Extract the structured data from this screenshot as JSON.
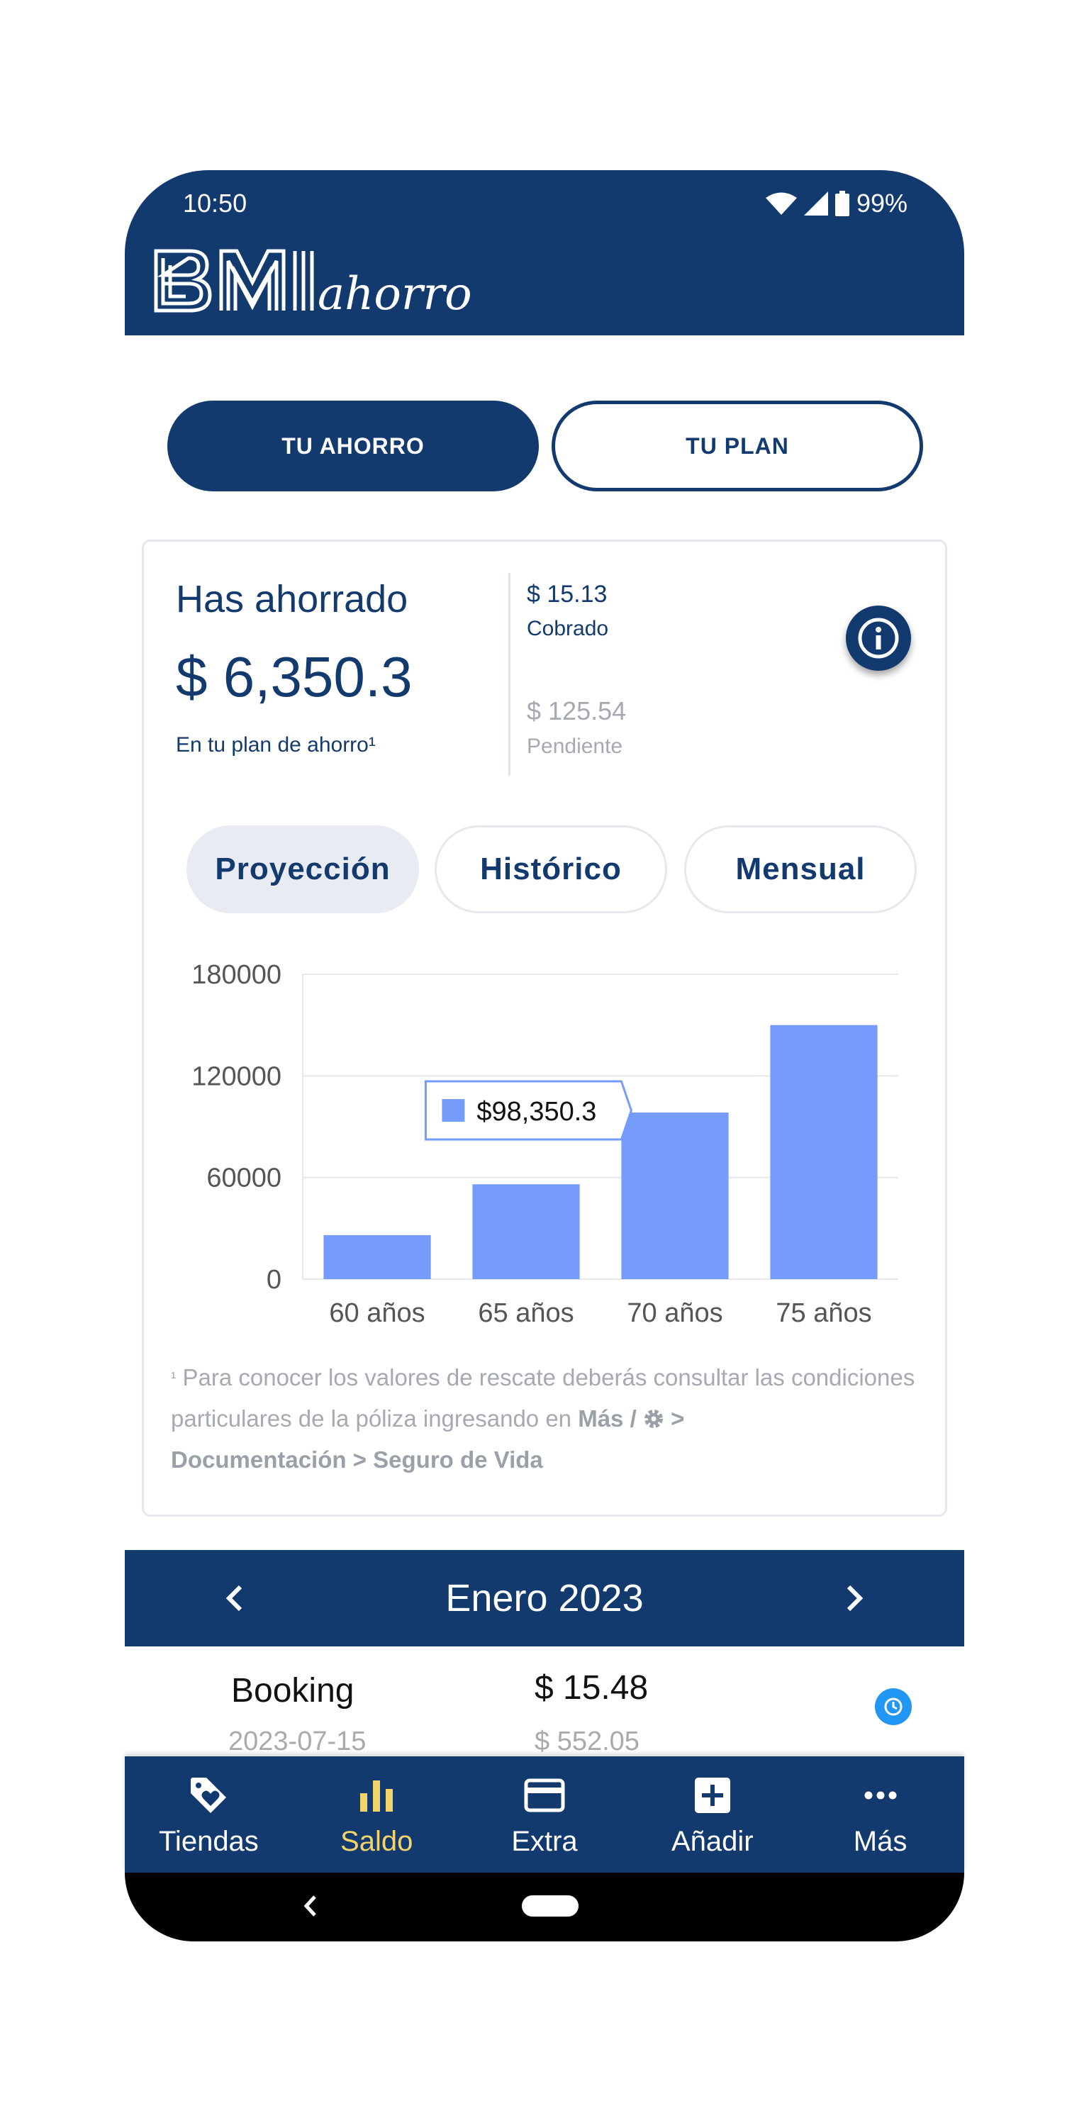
{
  "status": {
    "time": "10:50",
    "battery": "99%"
  },
  "brand": {
    "logo_text": "BMI",
    "logo_script": "ahorro"
  },
  "segments": {
    "active": "TU AHORRO",
    "inactive": "TU PLAN"
  },
  "savings": {
    "title": "Has ahorrado",
    "amount": "$ 6,350.3",
    "subtitle": "En tu plan de ahorro¹",
    "cobrado_value": "$ 15.13",
    "cobrado_label": "Cobrado",
    "pendiente_value": "$ 125.54",
    "pendiente_label": "Pendiente"
  },
  "chips": [
    "Proyección",
    "Histórico",
    "Mensual"
  ],
  "chart_data": {
    "type": "bar",
    "categories": [
      "60 años",
      "65 años",
      "70 años",
      "75 años"
    ],
    "values": [
      26000,
      56000,
      98350.3,
      150000
    ],
    "ylim": [
      0,
      180000
    ],
    "yticks": [
      "0",
      "60000",
      "120000",
      "180000"
    ],
    "tooltip": {
      "category": "70 años",
      "label": "$98,350.3"
    },
    "grid": true,
    "color": "#759cfb"
  },
  "footnote": {
    "sup": "¹",
    "text": "Para conocer los valores de rescate deberás consultar las condiciones particulares de la póliza ingresando en",
    "bold1": "Más /",
    "gt": ">",
    "bold2": "Documentación > Seguro de Vida"
  },
  "month": {
    "title": "Enero 2023"
  },
  "transaction": {
    "name": "Booking",
    "amount": "$ 15.48",
    "date": "2023-07-15",
    "sub": "$ 552.05"
  },
  "nav": [
    {
      "label": "Tiendas",
      "icon": "tag-heart-icon"
    },
    {
      "label": "Saldo",
      "icon": "bar-chart-icon"
    },
    {
      "label": "Extra",
      "icon": "credit-card-icon"
    },
    {
      "label": "Añadir",
      "icon": "plus-box-icon"
    },
    {
      "label": "Más",
      "icon": "more-dots-icon"
    }
  ],
  "colors": {
    "primary": "#133a6f",
    "accent": "#f3d46a",
    "bar": "#759cfb",
    "muted": "#a6a9b2"
  }
}
